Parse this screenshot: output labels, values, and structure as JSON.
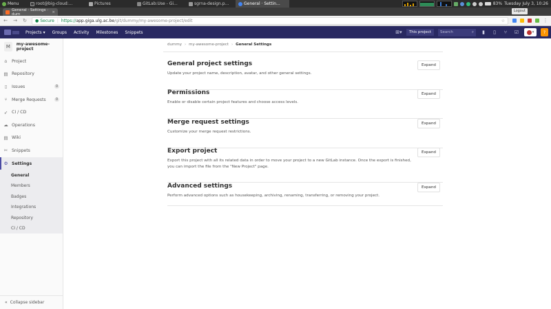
{
  "taskbar": {
    "menu_label": "Menu",
    "tasks": [
      {
        "label": "root@big-cloud:..."
      },
      {
        "label": "Pictures"
      },
      {
        "label": "GitLab:Use - Gi..."
      },
      {
        "label": "sgrna-design.p..."
      },
      {
        "label": "General · Settin..."
      }
    ],
    "battery": "83%",
    "datetime": "Tuesday July  3, 10:26"
  },
  "browser": {
    "tab_title": "General · Settings · dum",
    "tab_close": "×",
    "logout_label": "Logout",
    "secure_label": "Secure",
    "url_scheme": "https://",
    "url_host": "app.giga.ulg.ac.be",
    "url_path": "/git/dummy/my-awesome-project/edit"
  },
  "header": {
    "nav": [
      "Projects",
      "Groups",
      "Activity",
      "Milestones",
      "Snippets"
    ],
    "this_project": "This project",
    "search_placeholder": "Search"
  },
  "sidebar": {
    "project_initial": "M",
    "project_name": "my-awesome-project",
    "items": [
      {
        "label": "Project",
        "icon": "house-icon"
      },
      {
        "label": "Repository",
        "icon": "book-icon"
      },
      {
        "label": "Issues",
        "icon": "issues-icon",
        "count": "0"
      },
      {
        "label": "Merge Requests",
        "icon": "merge-icon",
        "count": "0"
      },
      {
        "label": "CI / CD",
        "icon": "rocket-icon"
      },
      {
        "label": "Operations",
        "icon": "cloud-icon"
      },
      {
        "label": "Wiki",
        "icon": "book-icon"
      },
      {
        "label": "Snippets",
        "icon": "scissors-icon"
      },
      {
        "label": "Settings",
        "icon": "gear-icon"
      }
    ],
    "settings_sub": [
      "General",
      "Members",
      "Badges",
      "Integrations",
      "Repository",
      "CI / CD"
    ],
    "collapse_label": "Collapse sidebar"
  },
  "breadcrumb": [
    "dummy",
    "my-awesome-project",
    "General Settings"
  ],
  "sections": [
    {
      "title": "General project settings",
      "desc": "Update your project name, description, avatar, and other general settings.",
      "button": "Expand"
    },
    {
      "title": "Permissions",
      "desc": "Enable or disable certain project features and choose access levels.",
      "button": "Expand"
    },
    {
      "title": "Merge request settings",
      "desc": "Customize your merge request restrictions.",
      "button": "Expand"
    },
    {
      "title": "Export project",
      "desc": "Export this project with all its related data in order to move your project to a new GitLab instance. Once the export is finished, you can import the file from the \"New Project\" page.",
      "button": "Expand"
    },
    {
      "title": "Advanced settings",
      "desc": "Perform advanced options such as housekeeping, archiving, renaming, transferring, or removing your project.",
      "button": "Expand"
    }
  ]
}
